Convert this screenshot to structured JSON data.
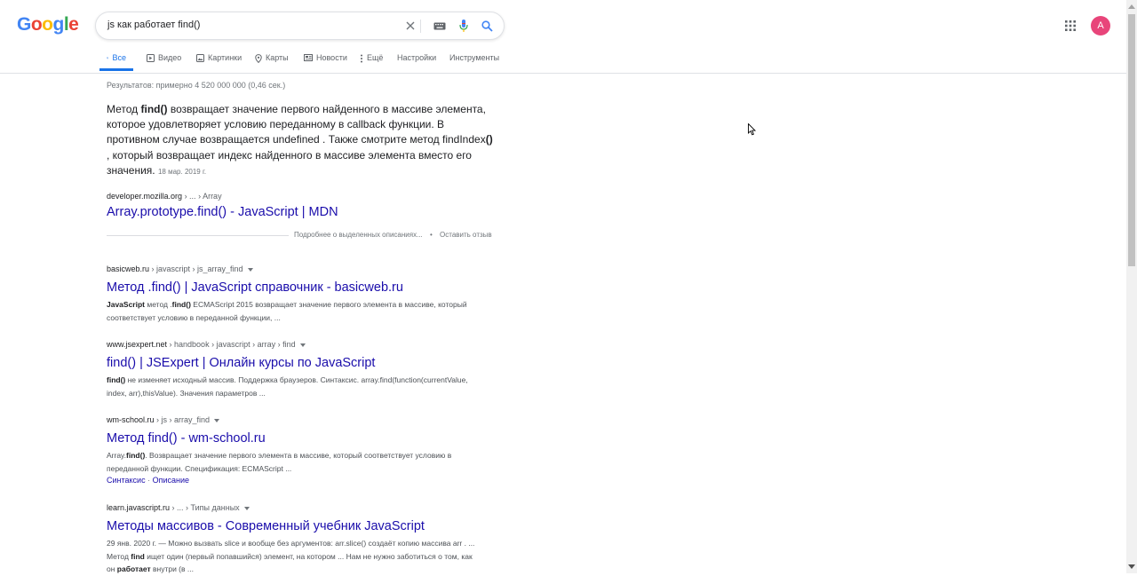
{
  "logo": {
    "letters": [
      "G",
      "o",
      "o",
      "g",
      "l",
      "e"
    ]
  },
  "search": {
    "query": "js как работает find()",
    "icons": [
      "clear-icon",
      "keyboard-icon",
      "mic-icon",
      "search-icon"
    ]
  },
  "account": {
    "initial": "A",
    "color": "#e8457a"
  },
  "tabs": {
    "all": "Все",
    "video": "Видео",
    "images": "Картинки",
    "maps": "Карты",
    "news": "Новости",
    "more": "Ещё",
    "settings": "Настройки",
    "tools": "Инструменты"
  },
  "stats": "Результатов: примерно 4 520 000 000 (0,46 сек.)",
  "featured": {
    "p1": "Метод ",
    "b1": "find()",
    "p2": " возвращает значение первого найденного в массиве элемента, которое удовлетворяет условию переданному в callback функции. В противном случае возвращается undefined . Также смотрите метод findIndex",
    "b2": "()",
    "p3": " , который возвращает индекс найденного в массиве элемента вместо его значения.",
    "date": "18 мар. 2019 г.",
    "cite_domain": "developer.mozilla.org",
    "cite_path": " › ... › Array",
    "title": "Array.prototype.find() - JavaScript | MDN",
    "about": "Подробнее о выделенных описаниях...",
    "dot": "•",
    "feedback": "Оставить отзыв"
  },
  "results": [
    {
      "domain": "basicweb.ru",
      "path": " › javascript › js_array_find",
      "title": "Метод .find() | JavaScript справочник - basicweb.ru",
      "s1b": "JavaScript",
      "s1": " метод .",
      "s2b": "find()",
      "s2": " ECMAScript 2015 возвращает значение первого элемента в массиве, который соответствует условию в переданной функции, ..."
    },
    {
      "domain": "www.jsexpert.net",
      "path": " › handbook › javascript › array › find",
      "title": "find() | JSExpert | Онлайн курсы по JavaScript",
      "s1b": "find()",
      "s1": " не изменяет исходный массив. Поддержка браузеров. Синтаксис. array.",
      "s2b": "",
      "s2": "find(function(currentValue, index, arr),thisValue). Значения параметров ..."
    },
    {
      "domain": "wm-school.ru",
      "path": " › js › array_find",
      "title": "Метод find() - wm-school.ru",
      "s1b": "",
      "s1": "Array.",
      "s2b": "find()",
      "s2": ". Возвращает значение первого элемента в массиве, который соответствует условию в переданной функции. Спецификация: ECMAScript ...",
      "link1": "Синтаксис",
      "linksep": " · ",
      "link2": "Описание"
    },
    {
      "domain": "learn.javascript.ru",
      "path": " › ... › Типы данных",
      "title": "Методы массивов - Современный учебник JavaScript",
      "s1b": "",
      "s1": "29 янв. 2020 г. — Можно вызвать slice и вообще без аргументов: arr.slice() создаёт копию массива arr . ... Метод ",
      "s2b": "find",
      "s2": " ищет один (первый попавшийся) элемент, на котором ... Нам не нужно заботиться о том, как он ",
      "s3b": "работает",
      "s3": " внутри (в ..."
    }
  ]
}
